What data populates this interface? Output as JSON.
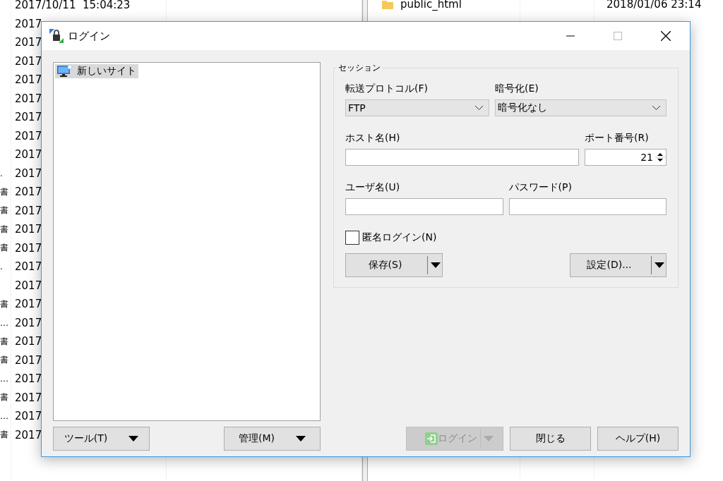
{
  "background": {
    "left_rows": [
      {
        "prefix": "",
        "text": "2017/10/11  15:04:23"
      },
      {
        "prefix": "",
        "text": "2017"
      },
      {
        "prefix": "",
        "text": "2017"
      },
      {
        "prefix": "",
        "text": "2017"
      },
      {
        "prefix": "",
        "text": "2017"
      },
      {
        "prefix": "",
        "text": "2017"
      },
      {
        "prefix": "",
        "text": "2017"
      },
      {
        "prefix": "",
        "text": "2017"
      },
      {
        "prefix": "",
        "text": "2017"
      },
      {
        "prefix": ".",
        "text": "2017"
      },
      {
        "prefix": "書",
        "text": "2017"
      },
      {
        "prefix": "書",
        "text": "2017"
      },
      {
        "prefix": "書",
        "text": "2017"
      },
      {
        "prefix": "書",
        "text": "2017"
      },
      {
        "prefix": ".",
        "text": "2017"
      },
      {
        "prefix": "",
        "text": "2017"
      },
      {
        "prefix": "書",
        "text": "2017"
      },
      {
        "prefix": "…",
        "text": "2017"
      },
      {
        "prefix": "書",
        "text": "2017"
      },
      {
        "prefix": "書",
        "text": "2017"
      },
      {
        "prefix": "…",
        "text": "2017"
      },
      {
        "prefix": "書",
        "text": "2017"
      },
      {
        "prefix": "…",
        "text": "2017"
      },
      {
        "prefix": "書",
        "text": "2017"
      }
    ],
    "right_rows": [
      {
        "name": "public_html",
        "modified": "2018/01/06 23:14"
      }
    ]
  },
  "dialog": {
    "title": "ログイン",
    "sites": [
      {
        "label": "新しいサイト",
        "selected": true
      }
    ],
    "session": {
      "legend": "セッション",
      "protocol": {
        "label": "転送プロトコル(F)",
        "value": "FTP"
      },
      "encryption": {
        "label": "暗号化(E)",
        "value": "暗号化なし"
      },
      "host": {
        "label": "ホスト名(H)"
      },
      "port": {
        "label": "ポート番号(R)",
        "value": "21"
      },
      "user": {
        "label": "ユーザ名(U)"
      },
      "password": {
        "label": "パスワード(P)"
      },
      "anonymous": {
        "label": "匿名ログイン(N)",
        "checked": false
      },
      "save_button": "保存(S)",
      "advanced_button": "設定(D)..."
    },
    "left_buttons": [
      {
        "label": "ツール(T)"
      },
      {
        "label": "管理(M)"
      }
    ],
    "footer_buttons": [
      {
        "label": "ログイン",
        "kind": "split",
        "disabled": true
      },
      {
        "label": "閉じる",
        "kind": "plain",
        "disabled": false
      },
      {
        "label": "ヘルプ(H)",
        "kind": "plain",
        "disabled": false
      }
    ]
  }
}
